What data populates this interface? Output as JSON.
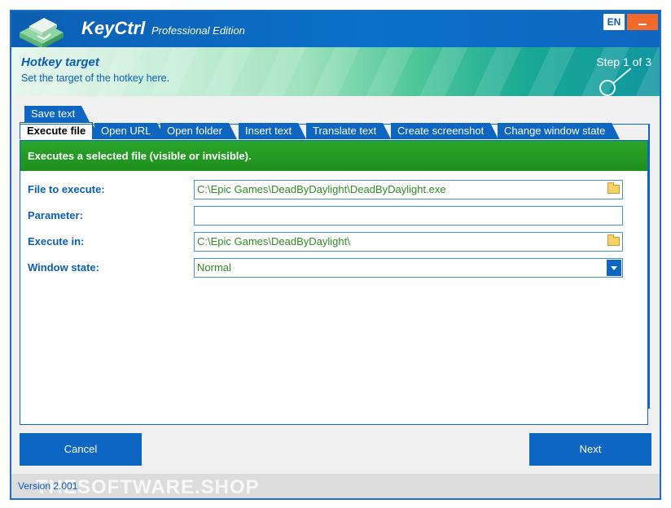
{
  "app": {
    "title": "KeyCtrl",
    "edition": "Professional Edition",
    "language": "EN"
  },
  "header": {
    "title": "Hotkey target",
    "subtitle": "Set the target of the hotkey here.",
    "step": "Step 1 of 3"
  },
  "tabs": {
    "row1": [
      "Save text"
    ],
    "row2": [
      "Execute file",
      "Open URL",
      "Open folder",
      "Insert text",
      "Translate text",
      "Create screenshot",
      "Change window state"
    ],
    "active": "Execute file"
  },
  "panel": {
    "banner": "Executes a selected file (visible or invisible).",
    "fields": [
      {
        "label": "File to execute:",
        "value": "C:\\Epic Games\\DeadByDaylight\\DeadByDaylight.exe",
        "control": "file"
      },
      {
        "label": "Parameter:",
        "value": "",
        "control": "text"
      },
      {
        "label": "Execute in:",
        "value": "C:\\Epic Games\\DeadByDaylight\\",
        "control": "folder"
      },
      {
        "label": "Window state:",
        "value": "Normal",
        "control": "dropdown"
      }
    ]
  },
  "buttons": {
    "cancel": "Cancel",
    "next": "Next"
  },
  "footer": {
    "version": "Version 2.001",
    "watermark": "THESOFTWARE.SHOP"
  },
  "colors": {
    "accent": "#0d66c2",
    "banner": "#229a22",
    "minimize": "#f16a2c",
    "value_text": "#2e8b24"
  }
}
